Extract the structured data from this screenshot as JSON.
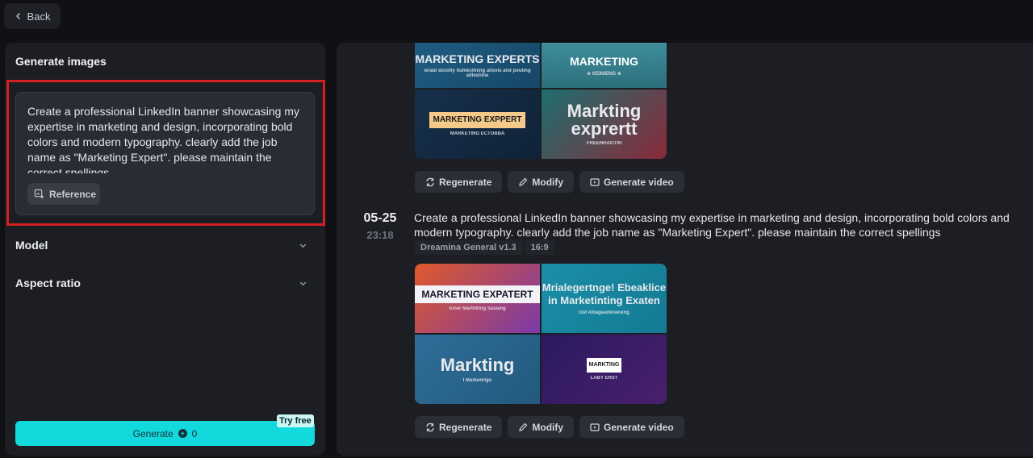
{
  "back_label": "Back",
  "left": {
    "title": "Generate images",
    "prompt": "Create a professional LinkedIn banner showcasing my expertise in marketing and design, incorporating bold colors and modern typography. clearly add the job name as \"Marketing Expert\". please maintain the correct spellings",
    "reference_label": "Reference",
    "model_label": "Model",
    "aspect_label": "Aspect ratio",
    "generate_label": "Generate",
    "generate_cost": "0",
    "try_free": "Try free"
  },
  "top_group": {
    "images": [
      {
        "main": "MARKETING EXPERTS",
        "sub": "wrald stclofly fiuhlectining aitsvis and pouting aitleshine",
        "colors": [
          "#1f5d82",
          "#164766"
        ]
      },
      {
        "main": "MARKETING",
        "sub": "★ KEINIENG ★",
        "colors": [
          "#3f8e9c",
          "#2c6f7c"
        ]
      },
      {
        "main": "MARKETING EXPPERT",
        "sub": "MARKETING ECTOBBA",
        "colors": [
          "#17304a",
          "#0f2238"
        ]
      },
      {
        "main": "Markting exprertt",
        "sub": "FREENHAGTIN",
        "colors": [
          "#1d6f6f",
          "#8a2a3a"
        ]
      }
    ],
    "actions": {
      "regenerate": "Regenerate",
      "modify": "Modify",
      "video": "Generate video"
    }
  },
  "second_group": {
    "date": "05-25",
    "time": "23:18",
    "prompt": "Create a professional LinkedIn banner showcasing my expertise in marketing and design, incorporating bold colors and modern typography. clearly add the job name as \"Marketing Expert\". please maintain the correct spellings",
    "model_tag": "Dreamina General v1.3",
    "ratio_tag": "16:9",
    "images": [
      {
        "main": "MARKETING EXPATERT",
        "sub": "Ainer Marthlting Sasiang",
        "colors": [
          "#e0592a",
          "#7a3aa8"
        ]
      },
      {
        "main": "Mrialegertnge! Ebeaklice in Marketinting Exaten",
        "sub": "Gst Alllageaiteraesing",
        "colors": [
          "#1b8fa8",
          "#137a92"
        ]
      },
      {
        "main": "Markting",
        "sub": "I Markenrigo",
        "colors": [
          "#2e6e98",
          "#23597d"
        ]
      },
      {
        "main": "MARKTING",
        "sub": "LABY ERST",
        "colors": [
          "#2a1a5e",
          "#4a1f6e"
        ]
      }
    ],
    "actions": {
      "regenerate": "Regenerate",
      "modify": "Modify",
      "video": "Generate video"
    }
  }
}
